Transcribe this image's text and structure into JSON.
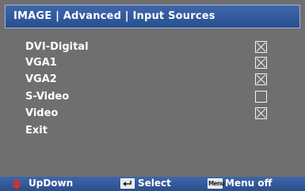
{
  "header": {
    "title": "IMAGE | Advanced | Input Sources"
  },
  "menu": {
    "items": [
      {
        "label": "DVI-Digital",
        "checked": true
      },
      {
        "label": "VGA1",
        "checked": true
      },
      {
        "label": "VGA2",
        "checked": true
      },
      {
        "label": "S-Video",
        "checked": false
      },
      {
        "label": "Video",
        "checked": true
      },
      {
        "label": "Exit",
        "checked": null
      }
    ]
  },
  "footer": {
    "updown_label": "UpDown",
    "select_label": "Select",
    "menu_icon_text": "Menu",
    "menu_off_label": "Menu off"
  },
  "colors": {
    "background": "#6f6f6f",
    "title_bar": "#3e66aa",
    "footer_bar": "#3e66aa",
    "updown_icon": "#e03020"
  }
}
